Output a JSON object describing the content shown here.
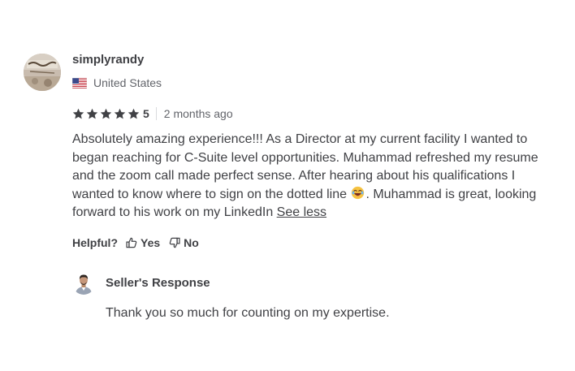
{
  "review": {
    "username": "simplyrandy",
    "country": "United States",
    "rating": "5",
    "stars_filled": 5,
    "time_ago": "2 months ago",
    "text_before_emoji": "Absolutely amazing experience!!! As a Director at my current facility I wanted to began reaching for C-Suite level opportunities. Muhammad refreshed my resume and the zoom call made perfect sense. After hearing about his qualifications I wanted to know where to sign on the dotted line",
    "text_after_emoji": ". Muhammad is great, looking forward to his work on my LinkedIn",
    "see_less": "See less",
    "emoji": "laughing-face-emoji"
  },
  "helpful": {
    "label": "Helpful?",
    "yes": "Yes",
    "no": "No"
  },
  "seller_response": {
    "title": "Seller's Response",
    "text": "Thank you so much for counting on my expertise."
  },
  "colors": {
    "text": "#404145",
    "muted": "#62646a",
    "star": "#404145",
    "divider": "#dadbdd"
  },
  "icons": {
    "flag": "us-flag-icon",
    "star": "star-icon",
    "yes": "thumbs-up-icon",
    "no": "thumbs-down-icon"
  }
}
